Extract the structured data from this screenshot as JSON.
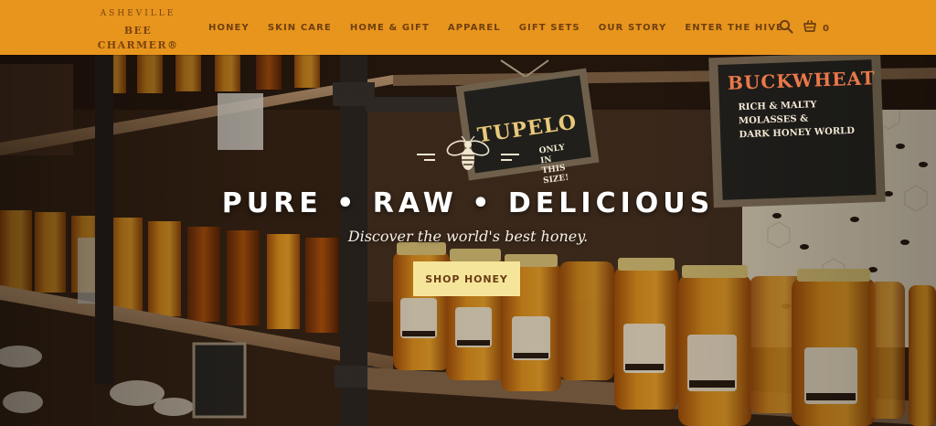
{
  "header": {
    "logo": {
      "top": "ASHEVILLE",
      "main": "BEE CHARMER®"
    },
    "nav": [
      {
        "label": "HONEY"
      },
      {
        "label": "SKIN CARE"
      },
      {
        "label": "HOME & GIFT"
      },
      {
        "label": "APPAREL"
      },
      {
        "label": "GIFT SETS"
      },
      {
        "label": "OUR STORY"
      },
      {
        "label": "ENTER THE HIVE"
      }
    ],
    "search_icon": "search-icon",
    "cart_icon": "cart-icon",
    "cart_count": "0"
  },
  "hero": {
    "headline": "PURE • RAW • DELICIOUS",
    "subline": "Discover the world's best honey.",
    "cta_label": "SHOP HONEY",
    "signs": {
      "tupelo": {
        "title": "TUPELO",
        "note": "ONLY IN THIS SIZE!"
      },
      "buckwheat": {
        "title": "BUCKWHEAT",
        "lines": [
          "RICH & MALTY",
          "MOLASSES &",
          "DARK HONEY WORLD"
        ]
      }
    }
  },
  "colors": {
    "header_bg": "#e8951d",
    "nav_text": "#6e3f10",
    "cta_bg": "#f5e59b",
    "cta_text": "#6a3c12",
    "honey": "#d9861a"
  }
}
